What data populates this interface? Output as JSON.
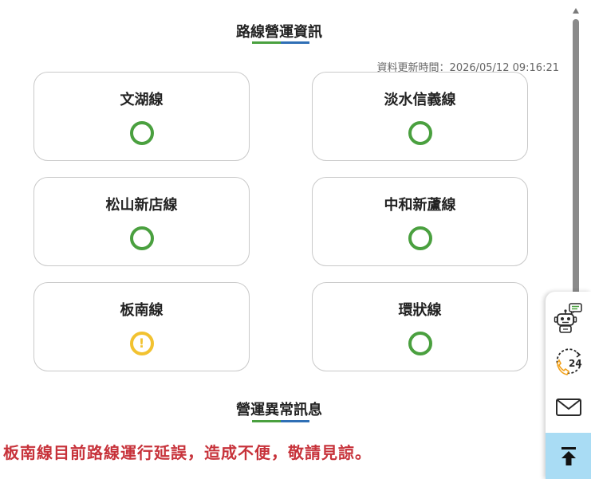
{
  "status_section": {
    "title": "路線營運資訊",
    "update_time": "資料更新時間：2026/05/12 09:16:21"
  },
  "lines": [
    {
      "name": "文湖線",
      "status": "normal",
      "status_icon": "ring-normal-icon"
    },
    {
      "name": "淡水信義線",
      "status": "normal",
      "status_icon": "ring-normal-icon"
    },
    {
      "name": "松山新店線",
      "status": "normal",
      "status_icon": "ring-normal-icon"
    },
    {
      "name": "中和新蘆線",
      "status": "normal",
      "status_icon": "ring-normal-icon"
    },
    {
      "name": "板南線",
      "status": "warning",
      "status_icon": "exclamation-warning-icon"
    },
    {
      "name": "環狀線",
      "status": "normal",
      "status_icon": "ring-normal-icon"
    }
  ],
  "notice_section": {
    "title": "營運異常訊息",
    "message": "板南線目前路線運行延誤，造成不便，敬請見諒。"
  },
  "floating_panel": {
    "icons": [
      "chatbot-icon",
      "24h-service-phone-icon",
      "mail-icon",
      "back-to-top-icon"
    ]
  },
  "colors": {
    "normal": "#4aa03f",
    "warning": "#f2c230",
    "notice_text": "#c7323a",
    "underline_green": "#4aa03f",
    "underline_blue": "#2f6fb5",
    "back_to_top_bg": "#a9dcf4"
  }
}
